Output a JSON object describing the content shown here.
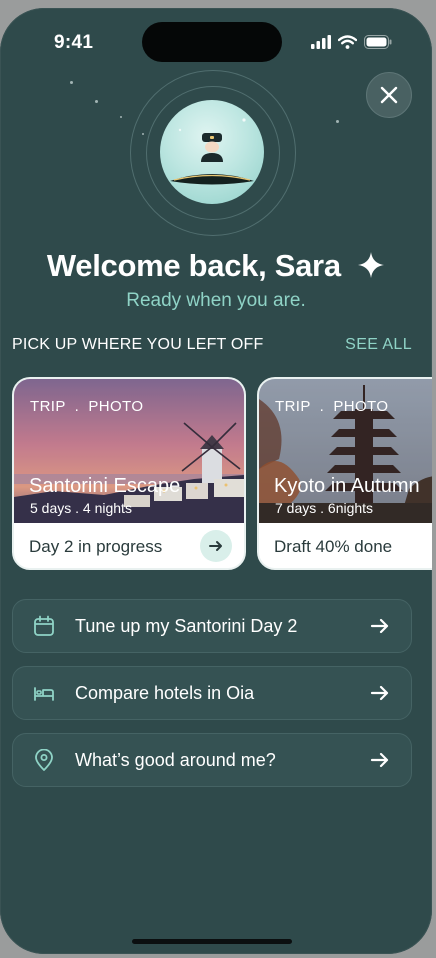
{
  "status_bar": {
    "time": "9:41"
  },
  "header": {
    "title": "Welcome back, Sara",
    "subtitle": "Ready when you are."
  },
  "section": {
    "label": "PICK UP WHERE YOU LEFT OFF",
    "see_all": "SEE ALL"
  },
  "cards": [
    {
      "meta": "TRIP  .  PHOTO",
      "name": "Santorini Escape",
      "duration": "5 days . 4 nights",
      "status": "Day 2 in progress"
    },
    {
      "meta": "TRIP  .  PHOTO",
      "name": "Kyoto in Autumn",
      "duration": "7 days . 6nights",
      "status": "Draft 40% done"
    }
  ],
  "actions": [
    {
      "label": "Tune up my Santorini Day 2",
      "icon": "calendar-icon"
    },
    {
      "label": "Compare hotels in Oia",
      "icon": "bed-icon"
    },
    {
      "label": "What’s good around me?",
      "icon": "location-pin-icon"
    }
  ],
  "colors": {
    "background": "#2f4a4b",
    "accent": "#8fd3c6",
    "card": "#ffffff"
  }
}
